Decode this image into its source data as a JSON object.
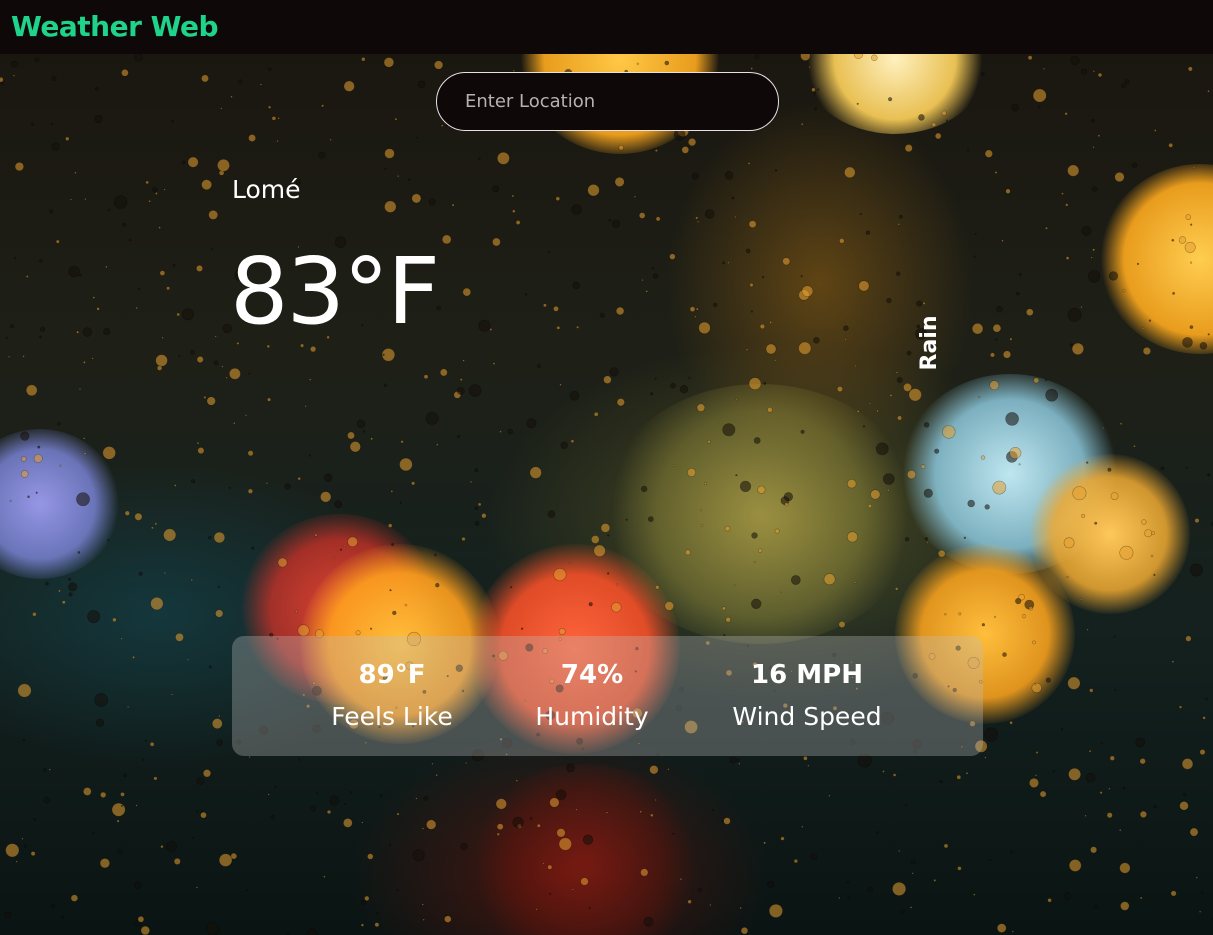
{
  "brand": {
    "title": "Weather Web"
  },
  "search": {
    "placeholder": "Enter Location",
    "value": ""
  },
  "weather": {
    "city": "Lomé",
    "temperature": "83°F",
    "condition": "Rain"
  },
  "stats": [
    {
      "value": "89°F",
      "label": "Feels Like"
    },
    {
      "value": "74%",
      "label": "Humidity"
    },
    {
      "value": "16 MPH",
      "label": "Wind Speed"
    }
  ],
  "colors": {
    "brand": "#1fd38a",
    "navbar": "#0f0809",
    "text": "#ffffff",
    "stats_panel": "rgba(190,190,190,0.33)"
  },
  "background": {
    "icon": "rainy-window-bokeh-photo"
  }
}
